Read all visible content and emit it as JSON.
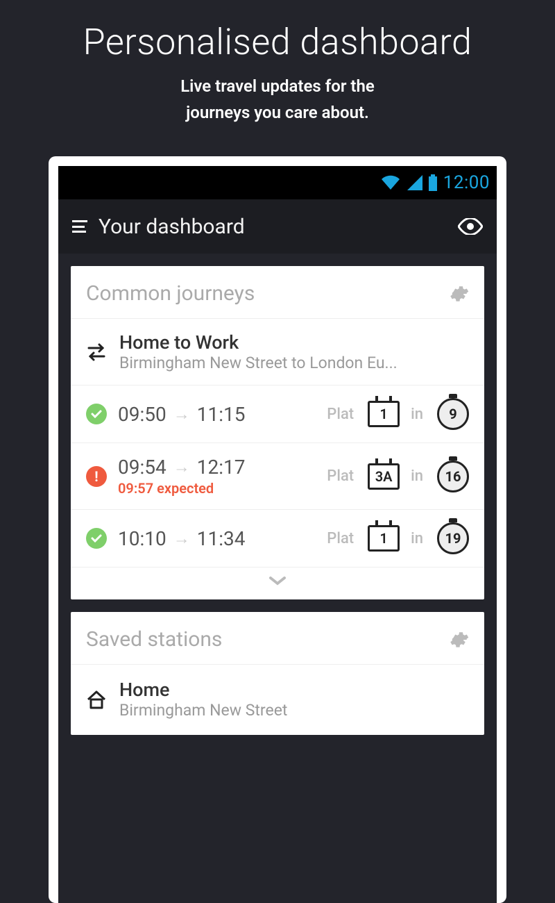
{
  "promo": {
    "title": "Personalised dashboard",
    "subtitle_line1": "Live travel updates for the",
    "subtitle_line2": "journeys you care about."
  },
  "statusbar": {
    "time": "12:00"
  },
  "appbar": {
    "title": "Your dashboard"
  },
  "common_journeys": {
    "heading": "Common journeys",
    "journey": {
      "title": "Home to Work",
      "subtitle": "Birmingham New Street to London Eu..."
    },
    "plat_label": "Plat",
    "in_label": "in",
    "departures": [
      {
        "status": "ok",
        "dep": "09:50",
        "arr": "11:15",
        "expected": "",
        "platform": "1",
        "in_min": "9"
      },
      {
        "status": "warn",
        "dep": "09:54",
        "arr": "12:17",
        "expected": "09:57 expected",
        "platform": "3A",
        "in_min": "16"
      },
      {
        "status": "ok",
        "dep": "10:10",
        "arr": "11:34",
        "expected": "",
        "platform": "1",
        "in_min": "19"
      }
    ]
  },
  "saved_stations": {
    "heading": "Saved stations",
    "items": [
      {
        "name": "Home",
        "station": "Birmingham New Street"
      }
    ]
  }
}
